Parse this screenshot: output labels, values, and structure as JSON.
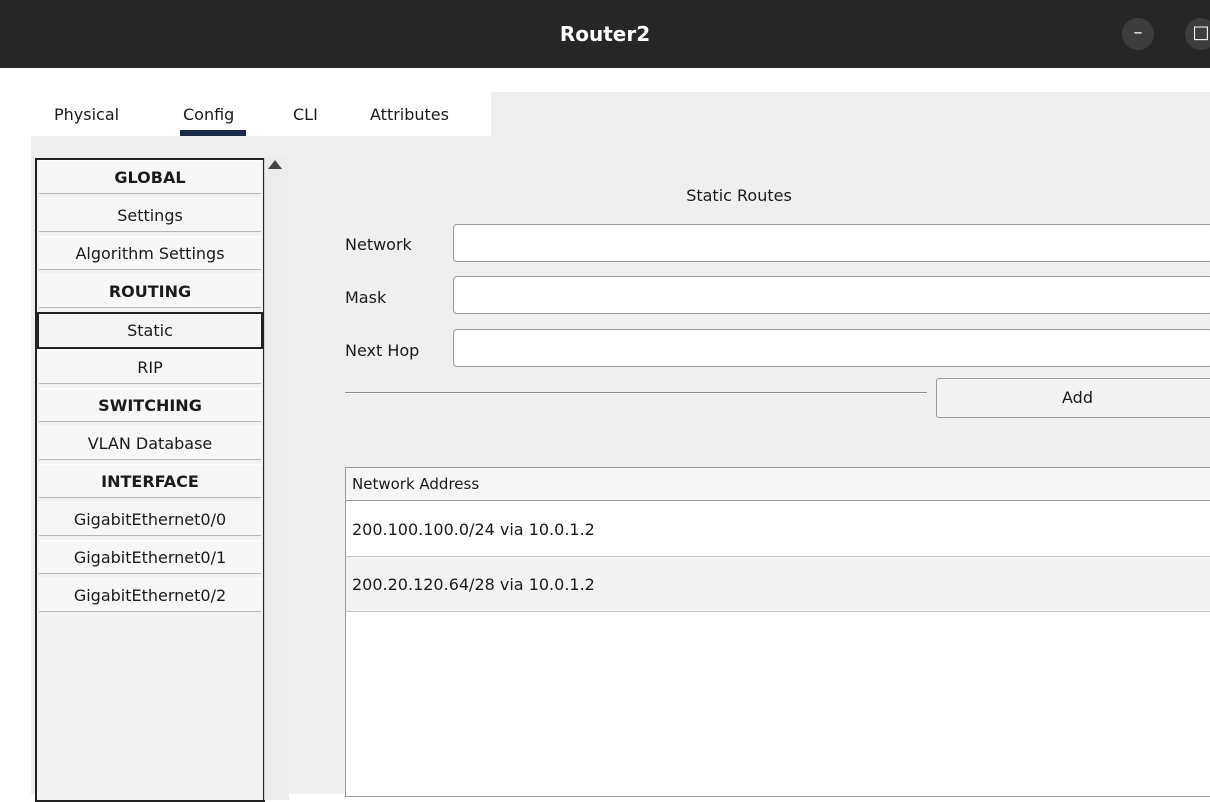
{
  "window": {
    "title": "Router2",
    "minimize_label": "–",
    "maximize_label": "□"
  },
  "tabs": [
    {
      "label": "Physical"
    },
    {
      "label": "Config"
    },
    {
      "label": "CLI"
    },
    {
      "label": "Attributes"
    }
  ],
  "active_tab": "Config",
  "sidebar": {
    "items": [
      {
        "label": "GLOBAL",
        "type": "header"
      },
      {
        "label": "Settings"
      },
      {
        "label": "Algorithm Settings"
      },
      {
        "label": "ROUTING",
        "type": "header"
      },
      {
        "label": "Static",
        "selected": true
      },
      {
        "label": "RIP"
      },
      {
        "label": "SWITCHING",
        "type": "header"
      },
      {
        "label": "VLAN Database"
      },
      {
        "label": "INTERFACE",
        "type": "header"
      },
      {
        "label": "GigabitEthernet0/0"
      },
      {
        "label": "GigabitEthernet0/1"
      },
      {
        "label": "GigabitEthernet0/2"
      }
    ]
  },
  "static_routes": {
    "title": "Static Routes",
    "network_label": "Network",
    "network_value": "",
    "mask_label": "Mask",
    "mask_value": "",
    "next_hop_label": "Next Hop",
    "next_hop_value": "",
    "add_label": "Add"
  },
  "routes_table": {
    "header": "Network Address",
    "rows": [
      "200.100.100.0/24 via 10.0.1.2",
      "200.20.120.64/28 via 10.0.1.2"
    ]
  }
}
